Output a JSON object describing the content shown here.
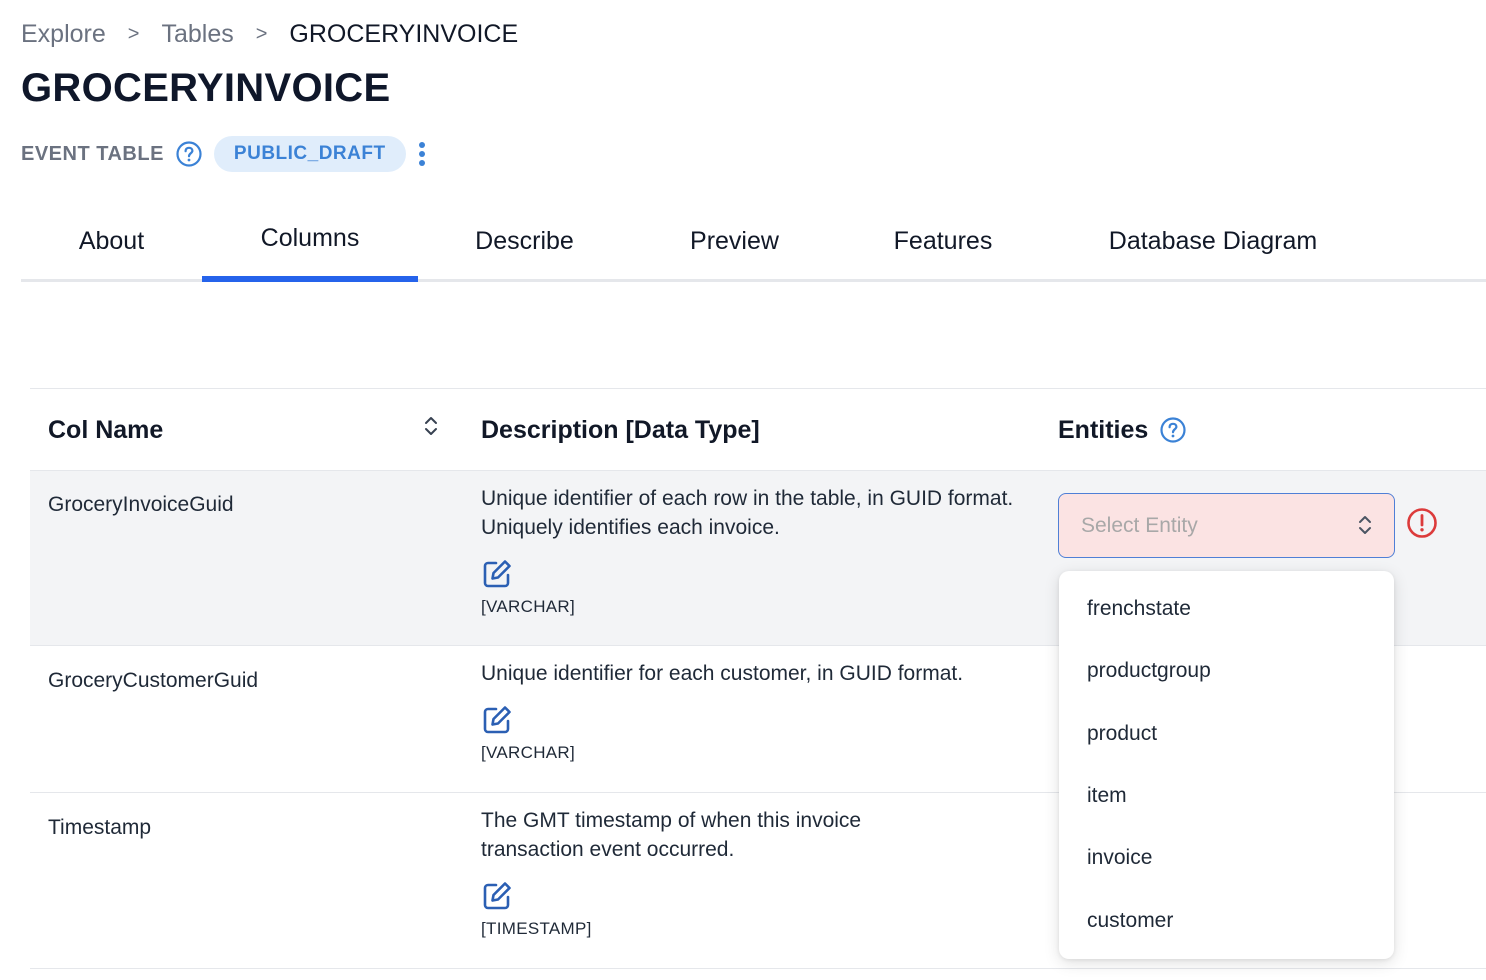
{
  "breadcrumb": {
    "items": [
      "Explore",
      "Tables"
    ],
    "separator": ">",
    "current": "GROCERYINVOICE"
  },
  "page": {
    "title": "GROCERYINVOICE",
    "table_type": "EVENT TABLE",
    "status": "PUBLIC_DRAFT"
  },
  "tabs": [
    {
      "label": "About"
    },
    {
      "label": "Columns",
      "active": true
    },
    {
      "label": "Describe"
    },
    {
      "label": "Preview"
    },
    {
      "label": "Features"
    },
    {
      "label": "Database Diagram"
    }
  ],
  "table": {
    "headers": {
      "col_name": "Col Name",
      "description": "Description [Data Type]",
      "entities": "Entities"
    },
    "rows": [
      {
        "name": "GroceryInvoiceGuid",
        "description": "Unique identifier of each row in the table, in GUID format. Uniquely identifies each invoice.",
        "dtype": "[VARCHAR]",
        "entity_placeholder": "Select Entity"
      },
      {
        "name": "GroceryCustomerGuid",
        "description": "Unique identifier for each customer, in GUID format.",
        "dtype": "[VARCHAR]"
      },
      {
        "name": "Timestamp",
        "description": "The GMT timestamp of when this invoice transaction event occurred.",
        "dtype": "[TIMESTAMP]"
      }
    ]
  },
  "entity_dropdown": {
    "options": [
      "frenchstate",
      "productgroup",
      "product",
      "item",
      "invoice",
      "customer"
    ]
  },
  "colors": {
    "accent": "#2563eb",
    "chip_bg": "#e0edfb",
    "chip_text": "#3b82d6",
    "error": "#dc3b3b",
    "select_error_bg": "#fbe3e3",
    "highlight_row": "#f3f4f6"
  },
  "icons": {
    "help": "question-circle-icon",
    "more": "kebab-menu-icon",
    "sort": "sort-chevrons-icon",
    "edit": "edit-pencil-icon",
    "select": "chevron-up-down-icon",
    "error": "exclamation-circle-icon"
  }
}
